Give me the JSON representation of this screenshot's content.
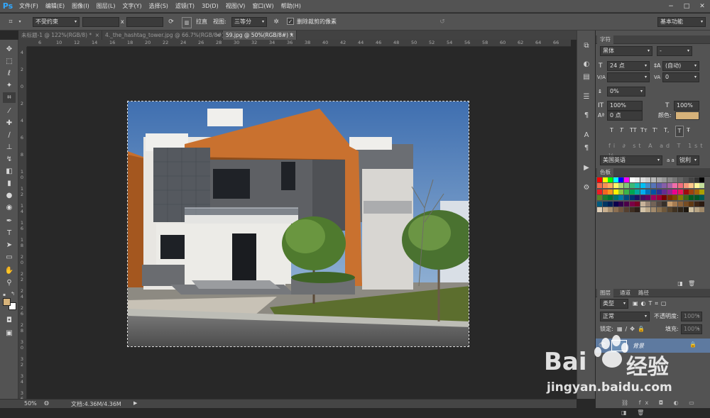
{
  "menubar": {
    "logo": "Ps",
    "items": [
      "文件(F)",
      "编辑(E)",
      "图像(I)",
      "图层(L)",
      "文字(Y)",
      "选择(S)",
      "滤镜(T)",
      "3D(D)",
      "视图(V)",
      "窗口(W)",
      "帮助(H)"
    ],
    "window_controls": [
      "−",
      "□",
      "✕"
    ]
  },
  "options": {
    "ratio_select": "不受约束",
    "x_label": "x",
    "straighten_label": "拉直",
    "view_label": "视图:",
    "view_select": "三等分",
    "delete_cropped_label": "删除裁剪的像素",
    "workspace_select": "基本功能"
  },
  "tabs": [
    {
      "label": "未标题-1 @ 122%(RGB/8) *",
      "close": "×"
    },
    {
      "label": "4._the_hashtag_tower.jpg @ 66.7%(RGB/8#)",
      "close": "×"
    },
    {
      "label": "59.jpg @ 50%(RGB/8#) *",
      "close": "×"
    }
  ],
  "ruler_h": [
    "6",
    "10",
    "12",
    "14",
    "16",
    "18",
    "20",
    "22",
    "24",
    "26",
    "28",
    "30",
    "32",
    "34",
    "36",
    "38",
    "40",
    "42",
    "44",
    "46",
    "48",
    "50",
    "52",
    "54",
    "56",
    "58",
    "60",
    "62",
    "64",
    "66",
    "68"
  ],
  "ruler_v": [
    "4",
    "2",
    "0",
    "2",
    "4",
    "6",
    "8",
    "1 0",
    "1 2",
    "1 4",
    "1 6",
    "1 8",
    "2 0",
    "2 2",
    "2 4",
    "2 6",
    "2 8",
    "3 0",
    "3 2",
    "3 4",
    "3 6"
  ],
  "status": {
    "zoom": "50%",
    "doc_info": "文档:4.36M/4.36M"
  },
  "character_panel": {
    "tab": "字符",
    "font_family": "黑体",
    "font_style": "-",
    "font_size": "24 点",
    "leading": "(自动)",
    "kerning_label": "V/A",
    "kerning": "",
    "tracking": "0",
    "scale_v_label": "0%",
    "scale_v": "100%",
    "scale_h": "100%",
    "baseline": "0 点",
    "color_label": "颜色:",
    "color_value": "#d6b27a",
    "style_buttons": [
      "T",
      "T",
      "TT",
      "Tт",
      "T'",
      "T,",
      "T",
      "Ŧ"
    ],
    "language": "美国英语",
    "antialias": "锐利",
    "antialias_prefix": "a a"
  },
  "swatches_panel": {
    "tab": "色板"
  },
  "layers_panel": {
    "tabs": [
      "图层",
      "通道",
      "路径"
    ],
    "filter_label": "类型",
    "blend_mode": "正常",
    "opacity_label": "不透明度:",
    "opacity_value": "100%",
    "lock_label": "锁定:",
    "fill_label": "填充:",
    "fill_value": "100%",
    "layer_name": "背景"
  },
  "watermark": {
    "brand": "Bai",
    "brand2": "经验",
    "url": "jingyan.baidu.com"
  },
  "colors": {
    "accent": "#31a8ff",
    "foreground": "#d6b27a",
    "background": "#ffffff",
    "selected_layer": "#5e7aa0"
  }
}
